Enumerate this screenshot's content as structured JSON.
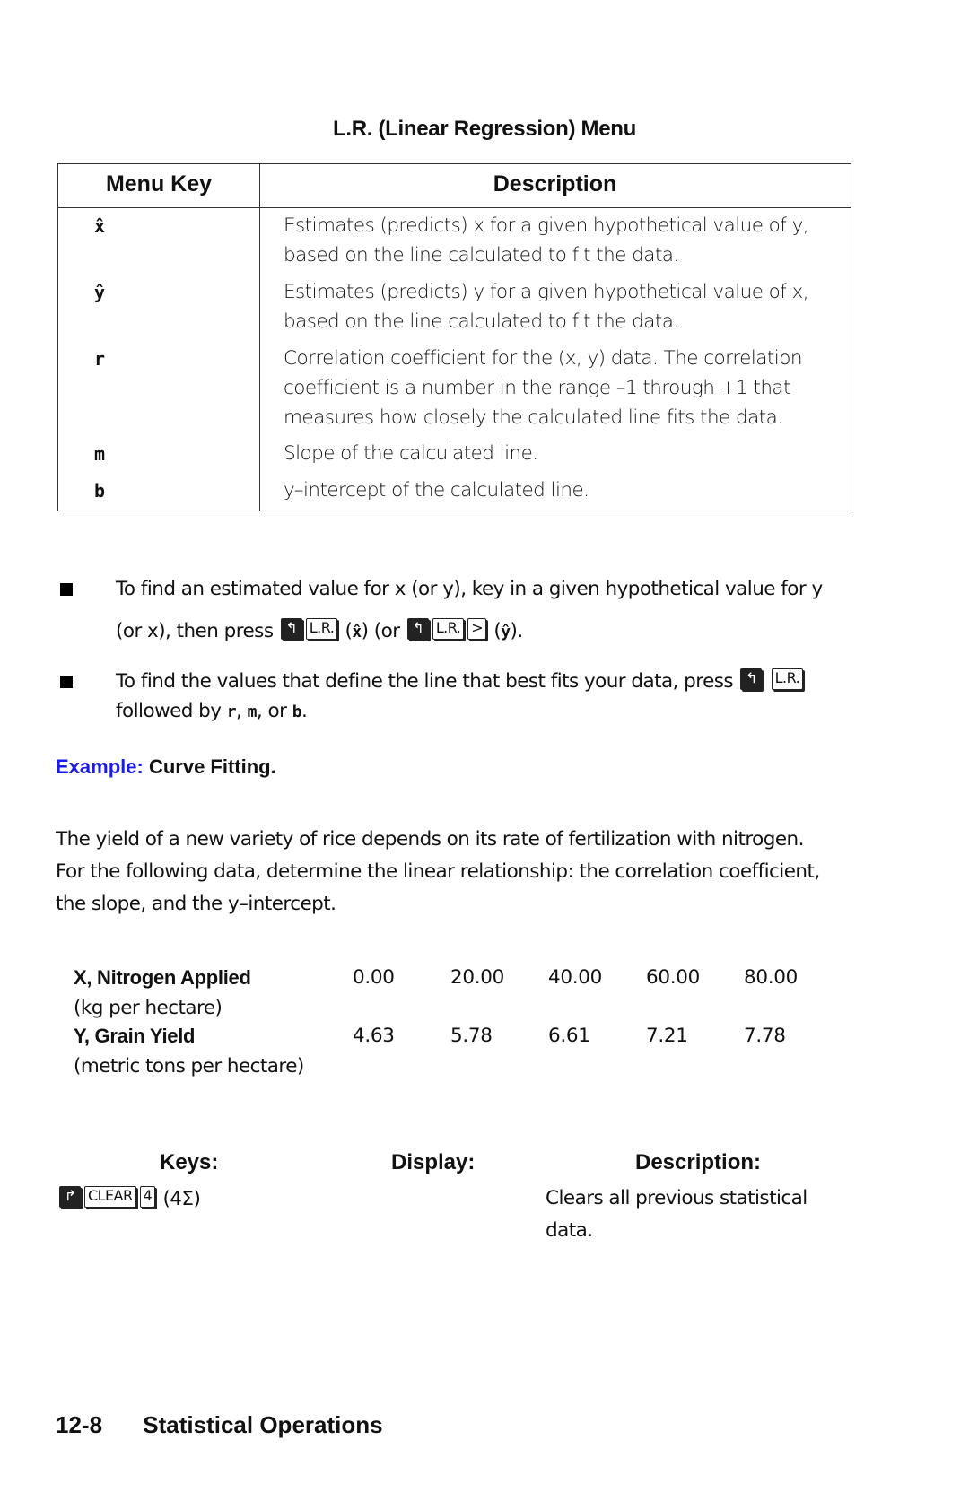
{
  "table": {
    "title": "L.R. (Linear Regression) Menu",
    "headers": {
      "key": "Menu Key",
      "description": "Description"
    },
    "rows": [
      {
        "key": "x̂",
        "lines": [
          "Estimates (predicts) x for a given hypothetical value of y,",
          "based on the line calculated to fit the data."
        ]
      },
      {
        "key": "ŷ",
        "lines": [
          "Estimates (predicts) y for a given hypothetical value of x,",
          "based on the line calculated to fit the data."
        ]
      },
      {
        "key": "r",
        "lines": [
          "Correlation coefficient for the (x, y) data. The correlation",
          "coefficient is a number in the range –1 through +1 that",
          "measures how closely the calculated line fits the data."
        ]
      },
      {
        "key": "m",
        "lines": [
          "Slope of the calculated line."
        ]
      },
      {
        "key": "b",
        "lines": [
          "y–intercept of the calculated line."
        ]
      }
    ]
  },
  "bullets": [
    {
      "line1": "To find an estimated value for x (or y), key in a given hypothetical value for y",
      "line2_prefix": "(or x), then press",
      "keys": {
        "shift_left": "↰",
        "lr": "L.R.",
        "next": ">"
      },
      "x_hat": "x̂",
      "or_text": ") (or",
      "y_hat": "ŷ"
    },
    {
      "line1": "To find the values that define the line that best fits your data, press",
      "line2_prefix": "followed by",
      "r": "r",
      "m": "m",
      "or": "or",
      "b": "b"
    }
  ],
  "example": {
    "label": "Example:",
    "title": "Curve Fitting.",
    "intro_lines": [
      "The yield of a new variety of rice depends on its rate of fertilization with nitrogen.",
      "For the following data, determine the linear relationship: the correlation coefficient,",
      "the slope, and the y–intercept."
    ],
    "data": {
      "x_label": "X, Nitrogen Applied",
      "x_unit": "(kg per hectare)",
      "x_values": [
        "0.00",
        "20.00",
        "40.00",
        "60.00",
        "80.00"
      ],
      "y_label": "Y, Grain Yield",
      "y_unit": "(metric tons per hectare)",
      "y_values": [
        "4.63",
        "5.78",
        "6.61",
        "7.21",
        "7.78"
      ]
    }
  },
  "steps": {
    "headers": {
      "keys": "Keys:",
      "display": "Display:",
      "description": "Description:"
    },
    "rows": [
      {
        "keys": {
          "shift_right": "↱",
          "clear": "CLEAR",
          "four": "4",
          "menu": "(4Σ)"
        },
        "display": "",
        "description_lines": [
          "Clears all previous statistical",
          "data."
        ]
      }
    ]
  },
  "footer": {
    "page": "12-8",
    "section": "Statistical Operations"
  }
}
